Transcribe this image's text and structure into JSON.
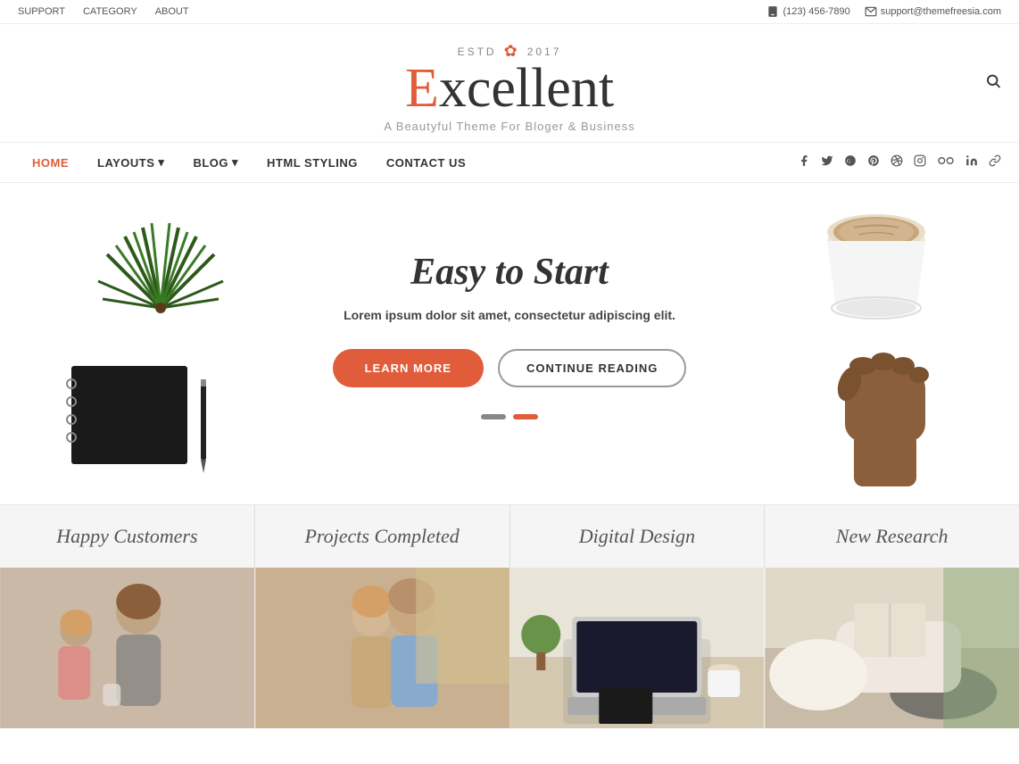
{
  "topbar": {
    "left_links": [
      "SUPPORT",
      "CATEGORY",
      "ABOUT"
    ],
    "phone": "(123) 456-7890",
    "email": "support@themefreesia.com"
  },
  "header": {
    "estd": "ESTD",
    "year": "2017",
    "logo": "Excellent",
    "logo_first": "E",
    "logo_rest": "xcellent",
    "subtitle": "A Beautyful Theme For Bloger & Business"
  },
  "nav": {
    "links": [
      {
        "label": "HOME",
        "active": true
      },
      {
        "label": "LAYOUTS",
        "has_dropdown": true
      },
      {
        "label": "BLOG",
        "has_dropdown": true
      },
      {
        "label": "HTML STYLING",
        "has_dropdown": false
      },
      {
        "label": "CONTACT US",
        "has_dropdown": false
      }
    ],
    "social_icons": [
      "facebook",
      "twitter",
      "google",
      "pinterest",
      "dribbble",
      "instagram",
      "flickr",
      "linkedin",
      "chain"
    ]
  },
  "hero": {
    "title": "Easy to Start",
    "subtitle": "Lorem ipsum dolor sit amet, consectetur adipiscing elit.",
    "btn_learn": "LEARN MORE",
    "btn_continue": "CONTINUE READING"
  },
  "stats": [
    {
      "label": "Happy Customers"
    },
    {
      "label": "Projects Completed"
    },
    {
      "label": "Digital Design"
    },
    {
      "label": "New Research"
    }
  ],
  "images": [
    {
      "alt": "Happy Customers - mother and child"
    },
    {
      "alt": "Projects Completed - couple"
    },
    {
      "alt": "Digital Design - laptop"
    },
    {
      "alt": "New Research - reading"
    }
  ]
}
